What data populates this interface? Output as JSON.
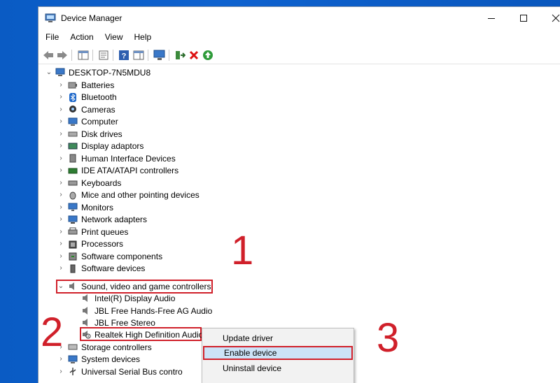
{
  "window": {
    "title": "Device Manager"
  },
  "menu": [
    "File",
    "Action",
    "View",
    "Help"
  ],
  "tree": {
    "root": "DESKTOP-7N5MDU8",
    "categories": [
      {
        "label": "Batteries",
        "icon": "battery-icon"
      },
      {
        "label": "Bluetooth",
        "icon": "bluetooth-icon"
      },
      {
        "label": "Cameras",
        "icon": "camera-icon"
      },
      {
        "label": "Computer",
        "icon": "computer-icon"
      },
      {
        "label": "Disk drives",
        "icon": "disk-drive-icon"
      },
      {
        "label": "Display adaptors",
        "icon": "display-adapter-icon"
      },
      {
        "label": "Human Interface Devices",
        "icon": "hid-icon"
      },
      {
        "label": "IDE ATA/ATAPI controllers",
        "icon": "ide-controller-icon"
      },
      {
        "label": "Keyboards",
        "icon": "keyboard-icon"
      },
      {
        "label": "Mice and other pointing devices",
        "icon": "mouse-icon"
      },
      {
        "label": "Monitors",
        "icon": "monitor-icon"
      },
      {
        "label": "Network adapters",
        "icon": "network-adapter-icon"
      },
      {
        "label": "Print queues",
        "icon": "printer-icon"
      },
      {
        "label": "Processors",
        "icon": "processor-icon"
      },
      {
        "label": "Software components",
        "icon": "software-component-icon"
      },
      {
        "label": "Software devices",
        "icon": "software-device-icon"
      }
    ],
    "sound": {
      "label": "Sound, video and game controllers",
      "children": [
        "Intel(R) Display Audio",
        "JBL Free Hands-Free AG Audio",
        "JBL Free Stereo",
        "Realtek High Definition Audio"
      ]
    },
    "after": [
      {
        "label": "Storage controllers",
        "icon": "storage-controller-icon"
      },
      {
        "label": "System devices",
        "icon": "system-device-icon"
      },
      {
        "label": "Universal Serial Bus contro",
        "icon": "usb-icon"
      }
    ]
  },
  "context_menu": {
    "items": [
      "Update driver",
      "Enable device",
      "Uninstall device"
    ],
    "highlighted": "Enable device"
  },
  "annotations": [
    "1",
    "2",
    "3"
  ],
  "colors": {
    "highlight_red": "#d0202a",
    "desktop_blue": "#0a5bc4",
    "menu_hover": "#cce3f7"
  }
}
